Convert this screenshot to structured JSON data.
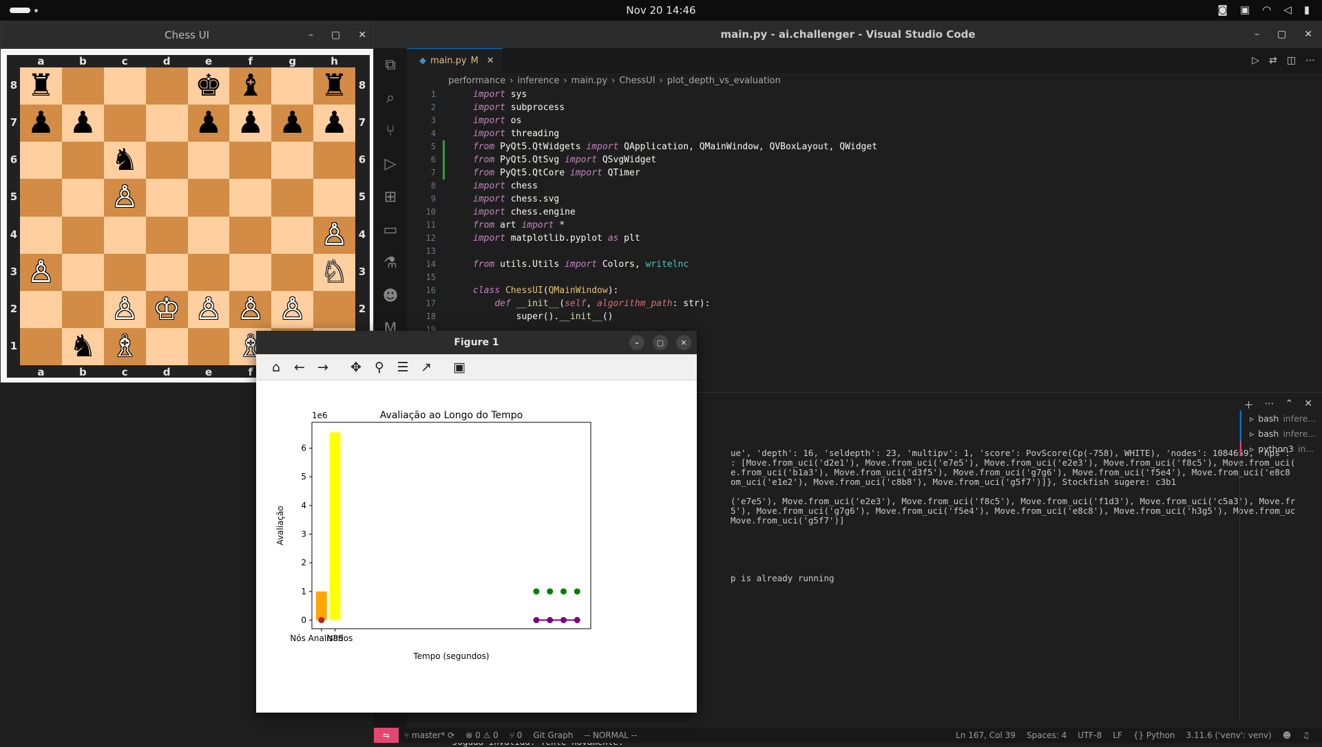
{
  "topbar": {
    "clock": "Nov 20  14:46"
  },
  "chess_window": {
    "title": "Chess UI",
    "files": [
      "a",
      "b",
      "c",
      "d",
      "e",
      "f",
      "g",
      "h"
    ],
    "ranks": [
      "8",
      "7",
      "6",
      "5",
      "4",
      "3",
      "2",
      "1"
    ],
    "pieces": {
      "a8": "♜",
      "e8": "♚",
      "f8": "♝",
      "h8": "♜",
      "a7": "♟",
      "b7": "♟",
      "e7": "♟",
      "f7": "♟",
      "g7": "♟",
      "h7": "♟",
      "c6": "♞",
      "c5": "♙",
      "h4": "♙",
      "a3": "♙",
      "h3": "♘",
      "c2": "♙",
      "d2": "♔",
      "e2": "♙",
      "f2": "♙",
      "g2": "♙",
      "b1": "♞",
      "c1": "♗",
      "f1": "♗"
    },
    "white_squares": [
      "c5",
      "h4",
      "a3",
      "h3",
      "c2",
      "d2",
      "e2",
      "f2",
      "g2",
      "c1",
      "f1"
    ]
  },
  "vscode": {
    "title": "main.py - ai.challenger - Visual Studio Code",
    "tab_label": "main.py",
    "tab_status": "M",
    "breadcrumb": [
      "performance",
      "inference",
      "main.py",
      "ChessUI",
      "plot_depth_vs_evaluation"
    ],
    "code_lines": [
      {
        "n": "1",
        "segs": [
          [
            "kw",
            "import"
          ],
          [
            "t",
            " sys"
          ]
        ]
      },
      {
        "n": "2",
        "segs": [
          [
            "kw",
            "import"
          ],
          [
            "t",
            " subprocess"
          ]
        ]
      },
      {
        "n": "3",
        "segs": [
          [
            "kw",
            "import"
          ],
          [
            "t",
            " os"
          ]
        ]
      },
      {
        "n": "4",
        "segs": [
          [
            "kw",
            "import"
          ],
          [
            "t",
            " threading"
          ]
        ]
      },
      {
        "n": "5",
        "mod": true,
        "segs": [
          [
            "kw",
            "from"
          ],
          [
            "t",
            " PyQt5.QtWidgets "
          ],
          [
            "kw",
            "import"
          ],
          [
            "t",
            " QApplication, QMainWindow, QVBoxLayout, QWidget"
          ]
        ]
      },
      {
        "n": "6",
        "mod": true,
        "segs": [
          [
            "kw",
            "from"
          ],
          [
            "t",
            " PyQt5.QtSvg "
          ],
          [
            "kw",
            "import"
          ],
          [
            "t",
            " QSvgWidget"
          ]
        ]
      },
      {
        "n": "7",
        "mod": true,
        "segs": [
          [
            "kw",
            "from"
          ],
          [
            "t",
            " PyQt5.QtCore "
          ],
          [
            "kw",
            "import"
          ],
          [
            "t",
            " QTimer"
          ]
        ]
      },
      {
        "n": "8",
        "segs": [
          [
            "kw",
            "import"
          ],
          [
            "t",
            " chess"
          ]
        ]
      },
      {
        "n": "9",
        "segs": [
          [
            "kw",
            "import"
          ],
          [
            "t",
            " chess.svg"
          ]
        ]
      },
      {
        "n": "10",
        "segs": [
          [
            "kw",
            "import"
          ],
          [
            "t",
            " chess.engine"
          ]
        ]
      },
      {
        "n": "11",
        "segs": [
          [
            "kw",
            "from"
          ],
          [
            "t",
            " art "
          ],
          [
            "kw",
            "import"
          ],
          [
            "t",
            " *"
          ]
        ]
      },
      {
        "n": "12",
        "segs": [
          [
            "kw",
            "import"
          ],
          [
            "t",
            " matplotlib.pyplot "
          ],
          [
            "kw",
            "as"
          ],
          [
            "t",
            " plt"
          ]
        ]
      },
      {
        "n": "13",
        "segs": []
      },
      {
        "n": "14",
        "segs": [
          [
            "kw",
            "from"
          ],
          [
            "t",
            " utils.Utils "
          ],
          [
            "kw",
            "import"
          ],
          [
            "t",
            " Colors, "
          ],
          [
            "teal",
            "writelnc"
          ]
        ]
      },
      {
        "n": "15",
        "segs": []
      },
      {
        "n": "16",
        "segs": [
          [
            "kw",
            "class"
          ],
          [
            "cls",
            " ChessUI"
          ],
          [
            "t",
            "("
          ],
          [
            "cls",
            "QMainWindow"
          ],
          [
            "t",
            "):"
          ]
        ]
      },
      {
        "n": "17",
        "segs": [
          [
            "t",
            "    "
          ],
          [
            "kw",
            "def"
          ],
          [
            "fn",
            " __init__"
          ],
          [
            "t",
            "("
          ],
          [
            "self",
            "self"
          ],
          [
            "t",
            ", "
          ],
          [
            "self",
            "algorithm_path"
          ],
          [
            "t",
            ": str):"
          ]
        ]
      },
      {
        "n": "18",
        "segs": [
          [
            "t",
            "        super()."
          ],
          [
            "fn",
            "__init__"
          ],
          [
            "t",
            "()"
          ]
        ]
      },
      {
        "n": "19",
        "segs": []
      }
    ],
    "terminal_lines": [
      "ue', 'depth': 16, 'seldepth': 23, 'multipv': 1, 'score': PovScore(Cp(-758), WHITE), 'nodes': 1084659, 'nps':",
      ": [Move.from_uci('d2e1'), Move.from_uci('e7e5'), Move.from_uci('e2e3'), Move.from_uci('f8c5'), Move.from_uci(",
      "e.from_uci('b1a3'), Move.from_uci('d3f5'), Move.from_uci('g7g6'), Move.from_uci('f5e4'), Move.from_uci('e8c8",
      "om_uci('e1e2'), Move.from_uci('c8b8'), Move.from_uci('g5f7')]}, Stockfish sugere: c3b1",
      "",
      "('e7e5'), Move.from_uci('e2e3'), Move.from_uci('f8c5'), Move.from_uci('f1d3'), Move.from_uci('c5a3'), Move.fr",
      "5'), Move.from_uci('g7g6'), Move.from_uci('f5e4'), Move.from_uci('e8c8'), Move.from_uci('h3g5'), Move.from_uc",
      "Move.from_uci('g5f7')]",
      "",
      "",
      "",
      "",
      "",
      "p is already running"
    ],
    "terminal_last": "Jogada inválida. Tente novamente.",
    "terminals": [
      {
        "name": "bash",
        "sub": "infere..."
      },
      {
        "name": "bash",
        "sub": "infere..."
      },
      {
        "name": "python3",
        "sub": "in..."
      }
    ],
    "status": {
      "branch": "master*",
      "problems": "0 ⚠ 0",
      "ports": "0",
      "gitgraph": "Git Graph",
      "mode": "-- NORMAL --",
      "position": "Ln 167, Col 39",
      "spaces": "Spaces: 4",
      "encoding": "UTF-8",
      "eol": "LF",
      "language": "Python",
      "interpreter": "3.11.6 ('venv': venv)"
    }
  },
  "figure": {
    "title": "Figure 1"
  },
  "chart_data": {
    "type": "bar",
    "title": "Avaliação ao Longo do Tempo",
    "xlabel": "Tempo (segundos)",
    "ylabel": "Avaliação",
    "y_multiplier_label": "1e6",
    "ylim": [
      -0.3,
      6.9
    ],
    "yticks": [
      0,
      1,
      2,
      3,
      4,
      5,
      6
    ],
    "xtick_labels": [
      "Nós Analisados",
      "NPS"
    ],
    "bars": [
      {
        "label": "Nós Analisados",
        "value": 1.0,
        "color": "#ffa500"
      },
      {
        "label": "NPS",
        "value": 6.55,
        "color": "#ffff00"
      }
    ],
    "red_point": {
      "value": 0.0,
      "color": "#b22222"
    },
    "green_points": {
      "values": [
        1.0,
        1.0,
        1.0,
        1.0
      ],
      "color": "#008000"
    },
    "purple_line": {
      "values": [
        0.0,
        0.0,
        0.0,
        0.0
      ],
      "color": "#800080"
    }
  }
}
